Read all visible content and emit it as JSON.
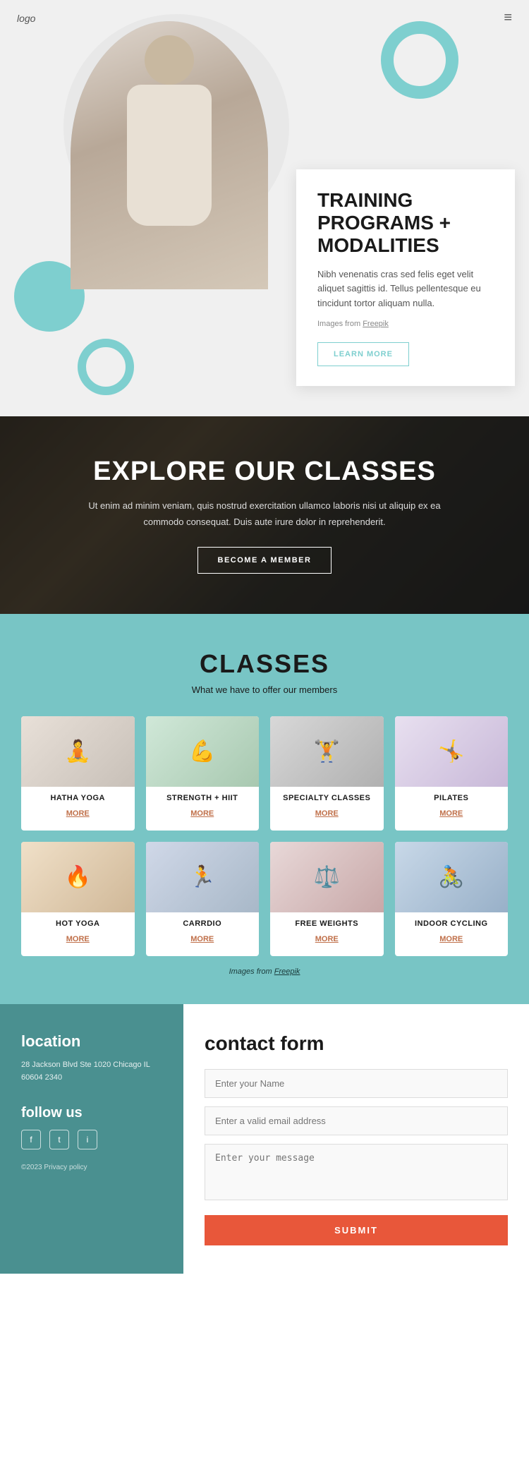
{
  "header": {
    "logo": "logo",
    "menu_icon": "≡"
  },
  "hero": {
    "title_line1": "TRAINING",
    "title_line2": "PROGRAMS +",
    "title_line3": "MODALITIES",
    "description": "Nibh venenatis cras sed felis eget velit aliquet sagittis id. Tellus pellentesque eu tincidunt tortor aliquam nulla.",
    "freepik_note": "Images from Freepik",
    "freepik_link": "Freepik",
    "learn_more_btn": "LEARN MORE"
  },
  "explore": {
    "title": "EXPLORE OUR CLASSES",
    "description": "Ut enim ad minim veniam, quis nostrud exercitation ullamco laboris nisi ut aliquip ex ea commodo consequat. Duis aute irure dolor in reprehenderit.",
    "become_member_btn": "BECOME A MEMBER"
  },
  "classes": {
    "title": "CLASSES",
    "subtitle": "What we have to offer our members",
    "freepik_credit": "Images from Freepik",
    "items": [
      {
        "name": "HATHA YOGA",
        "more": "MORE",
        "img_class": "img-hatha-yoga"
      },
      {
        "name": "STRENGTH + HIIT",
        "more": "MORE",
        "img_class": "img-strength"
      },
      {
        "name": "SPECIALTY CLASSES",
        "more": "MORE",
        "img_class": "img-specialty"
      },
      {
        "name": "PILATES",
        "more": "MORE",
        "img_class": "img-pilates"
      },
      {
        "name": "HOT YOGA",
        "more": "MORE",
        "img_class": "img-hot-yoga"
      },
      {
        "name": "CARRDIO",
        "more": "MORE",
        "img_class": "img-cardio"
      },
      {
        "name": "FREE WEIGHTS",
        "more": "MORE",
        "img_class": "img-weights"
      },
      {
        "name": "INDOOR CYCLING",
        "more": "MORE",
        "img_class": "img-cycling"
      }
    ]
  },
  "footer": {
    "location_title": "location",
    "address": "28 Jackson Blvd Ste 1020 Chicago\nIL 60604 2340",
    "follow_title": "follow us",
    "social_icons": [
      "f",
      "t",
      "i"
    ],
    "privacy": "©2023 Privacy policy",
    "contact_title": "contact form",
    "name_placeholder": "Enter your Name",
    "email_placeholder": "Enter a valid email address",
    "message_placeholder": "Enter your message",
    "submit_btn": "SUBMIT"
  }
}
